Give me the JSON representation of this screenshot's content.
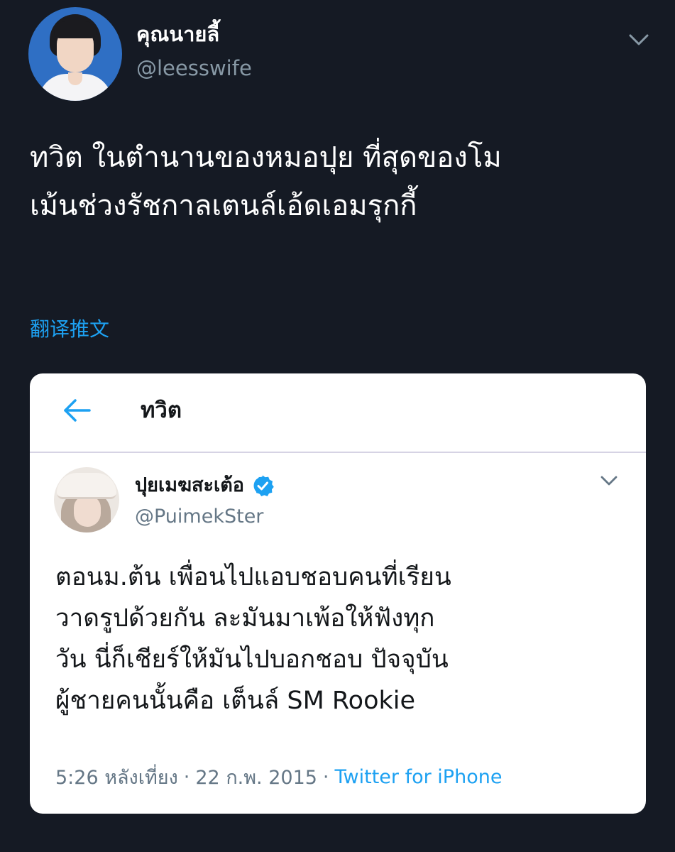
{
  "tweet": {
    "display_name": "คุณนายลี้",
    "handle": "@leesswife",
    "text_lines": [
      "ทวิต ในตำนานของหมอปุย ที่สุดของโม",
      "เม้นช่วงรัชกาลเตนล์เอ้ดเอมรุกกี้"
    ],
    "translate_label": "翻译推文",
    "icons": {
      "avatar": "user-avatar",
      "menu": "chevron-down-icon"
    }
  },
  "embedded": {
    "header_title": "ทวิต",
    "icons": {
      "back": "arrow-left-icon",
      "verified": "verified-badge-icon",
      "menu": "chevron-down-icon"
    },
    "display_name": "ปุยเมฆสะเต้อ",
    "handle": "@PuimekSter",
    "text_lines": [
      "ตอนม.ต้น เพื่อนไปแอบชอบคนที่เรียน",
      "วาดรูปด้วยกัน ละมันมาเพ้อให้ฟังทุก",
      "วัน นี่ก็เชียร์ให้มันไปบอกชอบ ปัจจุบัน",
      "ผู้ชายคนนั้นคือ เต็นล์ SM Rookie"
    ],
    "time": "5:26 หลังเที่ยง",
    "separator": "·",
    "date": "22 ก.พ. 2015",
    "source": "Twitter for iPhone"
  },
  "colors": {
    "background": "#151a24",
    "accent": "#1da1f2",
    "muted": "#8899a6",
    "card": "#ffffff",
    "verified": "#1da1f2"
  }
}
